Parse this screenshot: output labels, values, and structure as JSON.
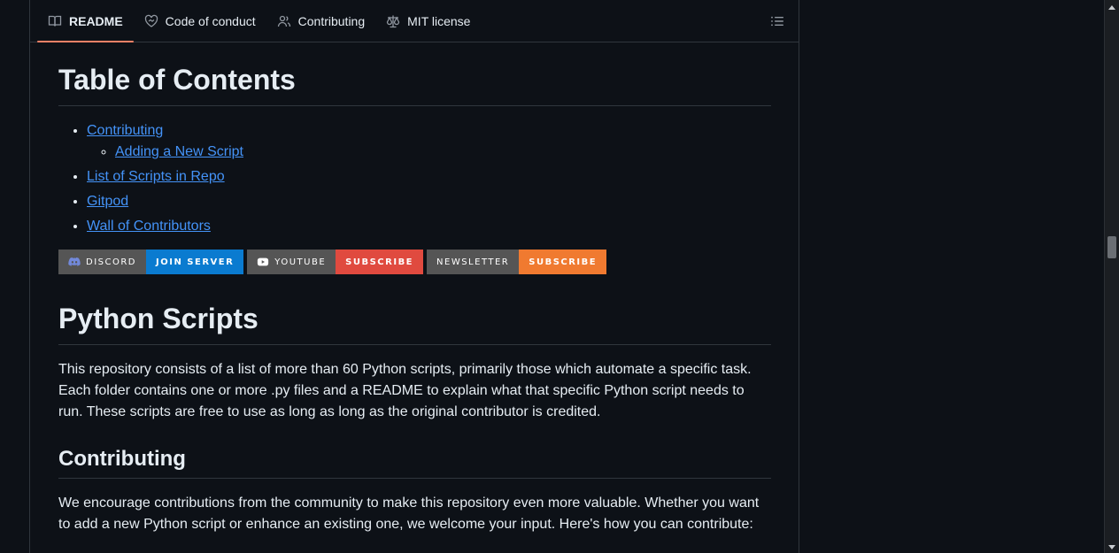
{
  "tabs": [
    {
      "label": "README",
      "icon": "book-icon",
      "active": true
    },
    {
      "label": "Code of conduct",
      "icon": "heart-icon"
    },
    {
      "label": "Contributing",
      "icon": "people-icon"
    },
    {
      "label": "MIT license",
      "icon": "law-icon"
    }
  ],
  "toc_button_icon": "list-unordered-icon",
  "toc_heading": "Table of Contents",
  "toc": {
    "contributing": "Contributing",
    "adding_new_script": "Adding a New Script",
    "list_of_scripts": "List of Scripts in Repo",
    "gitpod": "Gitpod",
    "wall_of_contributors": "Wall of Contributors"
  },
  "badges": {
    "discord": {
      "left": "DISCORD",
      "right": "JOIN SERVER",
      "right_color": "#0a7bd0",
      "icon": "discord-icon"
    },
    "youtube": {
      "left": "YOUTUBE",
      "right": "SUBSCRIBE",
      "right_color": "#e04a3f",
      "icon": "youtube-icon"
    },
    "newsletter": {
      "left": "NEWSLETTER",
      "right": "SUBSCRIBE",
      "right_color": "#f07a30"
    }
  },
  "python_heading": "Python Scripts",
  "python_paragraph": "This repository consists of a list of more than 60 Python scripts, primarily those which automate a specific task. Each folder contains one or more .py files and a README to explain what that specific Python script needs to run. These scripts are free to use as long as long as the original contributor is credited.",
  "contributing_heading": "Contributing",
  "contributing_paragraph": "We encourage contributions from the community to make this repository even more valuable. Whether you want to add a new Python script or enhance an existing one, we welcome your input. Here's how you can contribute:",
  "colors": {
    "background": "#0d1117",
    "link": "#4493f8",
    "active_tab_underline": "#f78166",
    "border": "#30363d"
  }
}
